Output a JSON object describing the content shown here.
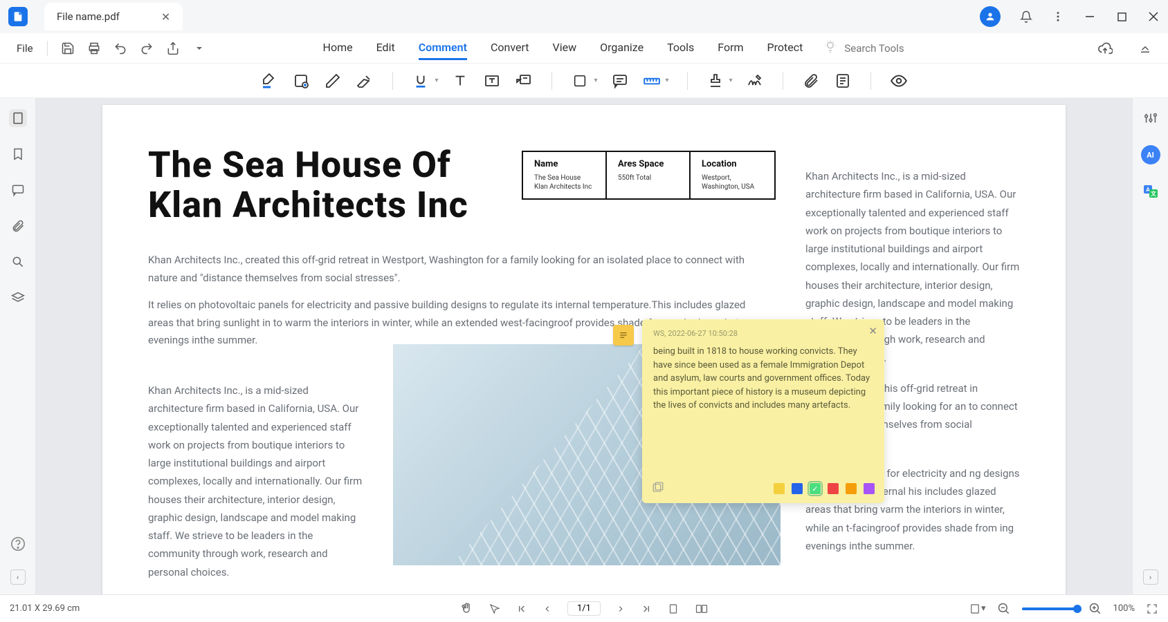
{
  "tab": {
    "filename": "File name.pdf"
  },
  "menu": {
    "file": "File",
    "tabs": [
      "Home",
      "Edit",
      "Comment",
      "Convert",
      "View",
      "Organize",
      "Tools",
      "Form",
      "Protect"
    ],
    "active_index": 2,
    "search_placeholder": "Search Tools"
  },
  "document": {
    "title_line1": "The Sea House Of",
    "title_line2": "Klan Architects Inc",
    "table": {
      "headers": [
        "Name",
        "Ares Space",
        "Location"
      ],
      "values": [
        "The Sea House Klan Architects Inc",
        "550ft Total",
        "Westport, Washington, USA"
      ]
    },
    "intro1": "Khan Architects Inc., created this off-grid retreat in Westport, Washington for a family looking for an isolated place to connect with nature and \"distance themselves from social stresses\".",
    "intro2": "It relies on photovoltaic panels for electricity and passive building designs to regulate its internal temperature.This includes glazed areas that bring sunlight in to warm the interiors in winter, while an extended west-facingroof provides shade from solar heat during evenings inthe summer.",
    "col_left": "Khan Architects Inc., is a mid-sized architecture firm based in California, USA. Our exceptionally talented and experienced staff work on projects from boutique interiors to large institutional buildings and airport complexes, locally and internationally. Our firm houses their architecture, interior design, graphic design, landscape and model making staff. We strieve to be leaders in the community through work, research and personal choices.",
    "col_right_1": "Khan Architects Inc., is a mid-sized architecture firm based in California, USA. Our exceptionally talented and experienced staff work on projects from boutique interiors to large institutional buildings and airport complexes, locally and internationally. Our firm houses their architecture, interior design, graphic design, landscape and model making staff. We strieve to be leaders in the community through work, research and personal choices.",
    "col_right_2": "cts Inc., created this off-grid retreat in shington for a family looking for an to connect with nature and mselves from social stresses\".",
    "col_right_3": "otovoltaic panels for electricity and ng designs to regulate its internal his includes glazed areas that bring varm the interiors in winter, while an t-facingroof provides shade from ing evenings inthe summer."
  },
  "sticky": {
    "author": "WS,",
    "timestamp": "2022-06-27 10:50:28",
    "body": "being built in 1818 to house working convicts. They have since been used as a female Immigration Depot and asylum, law courts and government offices. Today this important piece of history is a museum depicting the lives of convicts and includes many artefacts.",
    "colors": [
      "#f4d03f",
      "#2563eb",
      "#4ade80",
      "#ef4444",
      "#f59e0b",
      "#a855f7"
    ],
    "selected_color_index": 2
  },
  "status": {
    "dimensions": "21.01 X 29.69 cm",
    "page": "1/1",
    "zoom": "100%"
  }
}
